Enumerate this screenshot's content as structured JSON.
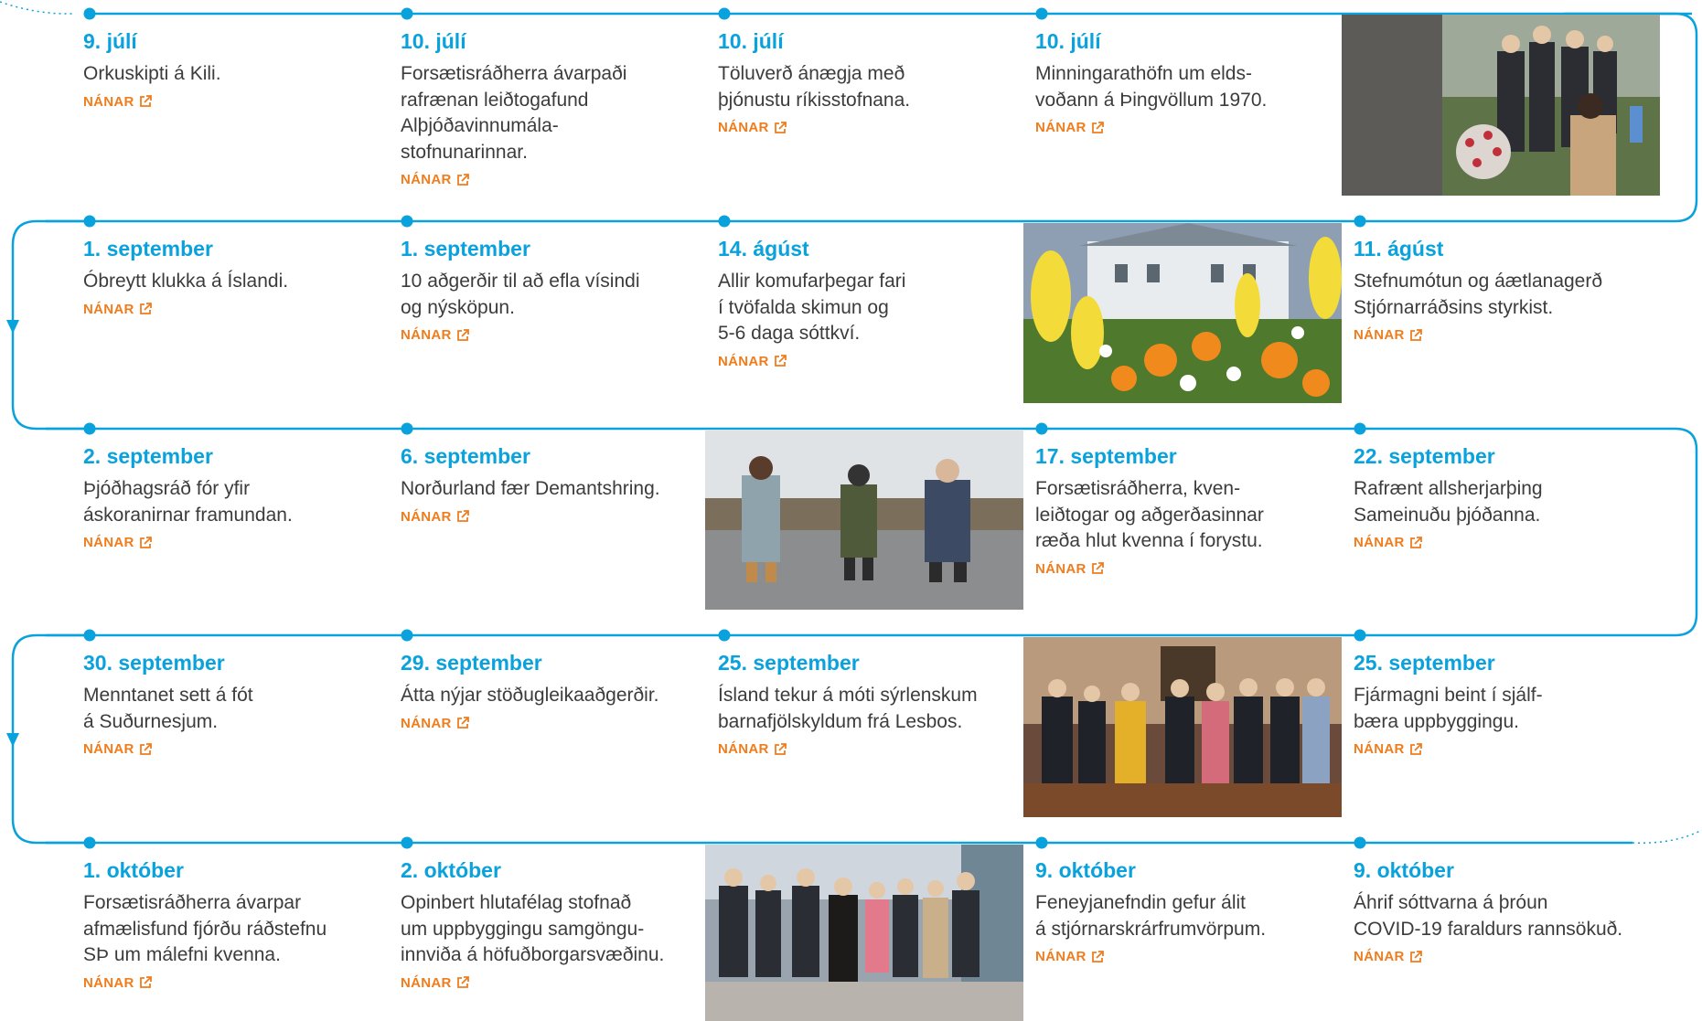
{
  "more_label": "NÁNAR",
  "colors": {
    "line": "#0aa2dc",
    "date": "#0aa2dc",
    "more": "#ef7d1e",
    "text": "#3c3c3c"
  },
  "rows": [
    [
      {
        "date": "9. júlí",
        "text": "Orkuskipti á Kili."
      },
      {
        "date": "10. júlí",
        "text": "Forsætisráðherra ávarpaði\nrafrænan leiðtogafund\nAlþjóðavinnumála-\nstofnunarinnar."
      },
      {
        "date": "10. júlí",
        "text": "Töluverð ánægja með\nþjónustu ríkisstofnana."
      },
      {
        "date": "10. júlí",
        "text": "Minningarathöfn um elds-\nvoðann á Þingvöllum 1970."
      }
    ],
    [
      {
        "date": "1. september",
        "text": "Óbreytt klukka á Íslandi."
      },
      {
        "date": "1. september",
        "text": "10 aðgerðir til að efla vísindi\nog nýsköpun."
      },
      {
        "date": "14. ágúst",
        "text": "Allir komufarþegar fari\ní tvöfalda skimun og\n5-6 daga sóttkví."
      },
      {
        "date": "11. ágúst",
        "text": "Stefnumótun og áætlanagerð\nStjórnarráðsins styrkist."
      }
    ],
    [
      {
        "date": "2. september",
        "text": "Þjóðhagsráð fór yfir\náskoranirnar framundan."
      },
      {
        "date": "6. september",
        "text": "Norðurland fær Demantshring."
      },
      {
        "date": "17. september",
        "text": "Forsætisráðherra, kven-\nleiðtogar og aðgerðasinnar\nræða hlut kvenna í forystu."
      },
      {
        "date": "22. september",
        "text": "Rafrænt allsherjarþing\nSameinuðu þjóðanna."
      }
    ],
    [
      {
        "date": "30. september",
        "text": "Menntanet sett á fót\ná Suðurnesjum."
      },
      {
        "date": "29. september",
        "text": "Átta nýjar stöðugleikaaðgerðir."
      },
      {
        "date": "25. september",
        "text": "Ísland tekur á móti sýrlenskum\nbarnafjölskyldum frá Lesbos."
      },
      {
        "date": "25. september",
        "text": "Fjármagni beint í sjálf-\nbæra uppbyggingu."
      }
    ],
    [
      {
        "date": "1. október",
        "text": "Forsætisráðherra ávarpar\nafmælisfund fjórðu ráðstefnu\nSÞ um málefni kvenna."
      },
      {
        "date": "2. október",
        "text": "Opinbert hlutafélag stofnað\num uppbyggingu samgöngu-\ninnviða á höfuðborgarsvæðinu."
      },
      {
        "date": "9. október",
        "text": "Feneyjanefndin gefur álit\ná stjórnarskrárfrumvörpum."
      },
      {
        "date": "9. október",
        "text": "Áhrif sóttvarna á þróun\nCOVID-19 faraldurs rannsökuð."
      }
    ]
  ]
}
